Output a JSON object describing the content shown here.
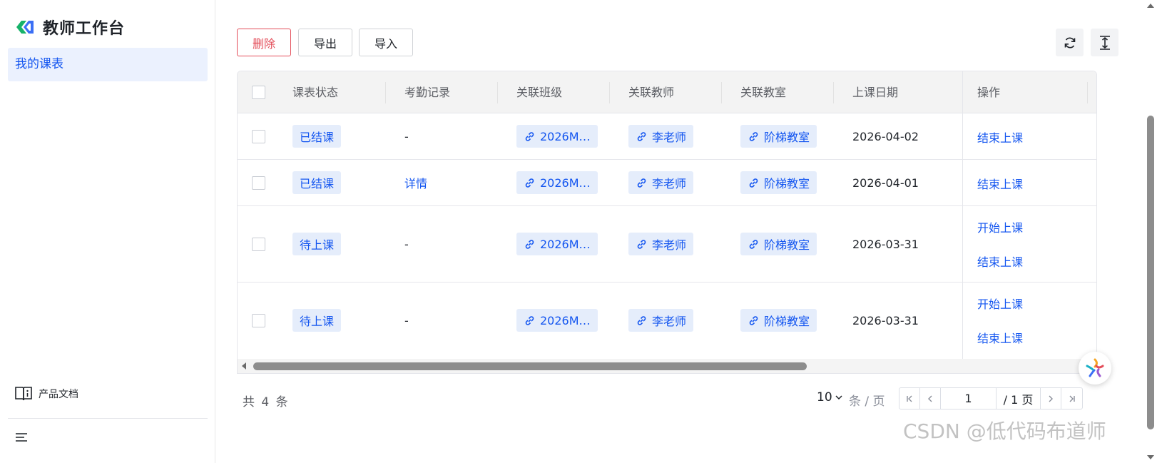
{
  "app": {
    "title": "教师工作台",
    "nav_active": "我的课表",
    "docs_label": "产品文档"
  },
  "toolbar": {
    "delete_label": "删除",
    "export_label": "导出",
    "import_label": "导入"
  },
  "colors": {
    "primary": "#1456f0",
    "danger": "#e34d59",
    "tag_bg": "#e5edfb",
    "nav_active_bg": "#ebf1fe"
  },
  "table": {
    "columns": [
      "课表状态",
      "考勤记录",
      "关联班级",
      "关联教师",
      "关联教室",
      "上课日期",
      "操作"
    ],
    "rows": [
      {
        "status": "已结课",
        "attendance": "-",
        "class": "2026M…",
        "teacher": "李老师",
        "room": "阶梯教室",
        "date": "2026-04-02",
        "actions": [
          "结束上课"
        ]
      },
      {
        "status": "已结课",
        "attendance": "详情",
        "class": "2026M…",
        "teacher": "李老师",
        "room": "阶梯教室",
        "date": "2026-04-01",
        "actions": [
          "结束上课"
        ]
      },
      {
        "status": "待上课",
        "attendance": "-",
        "class": "2026M…",
        "teacher": "李老师",
        "room": "阶梯教室",
        "date": "2026-03-31",
        "actions": [
          "开始上课",
          "结束上课"
        ]
      },
      {
        "status": "待上课",
        "attendance": "-",
        "class": "2026M…",
        "teacher": "李老师",
        "room": "阶梯教室",
        "date": "2026-03-31",
        "actions": [
          "开始上课",
          "结束上课"
        ]
      }
    ]
  },
  "footer": {
    "total_text": "共 4 条",
    "page_size": "10",
    "page_size_unit": "条 / 页",
    "current_page": "1",
    "total_pages_text": "/ 1 页"
  },
  "watermark": "CSDN @低代码布道师"
}
